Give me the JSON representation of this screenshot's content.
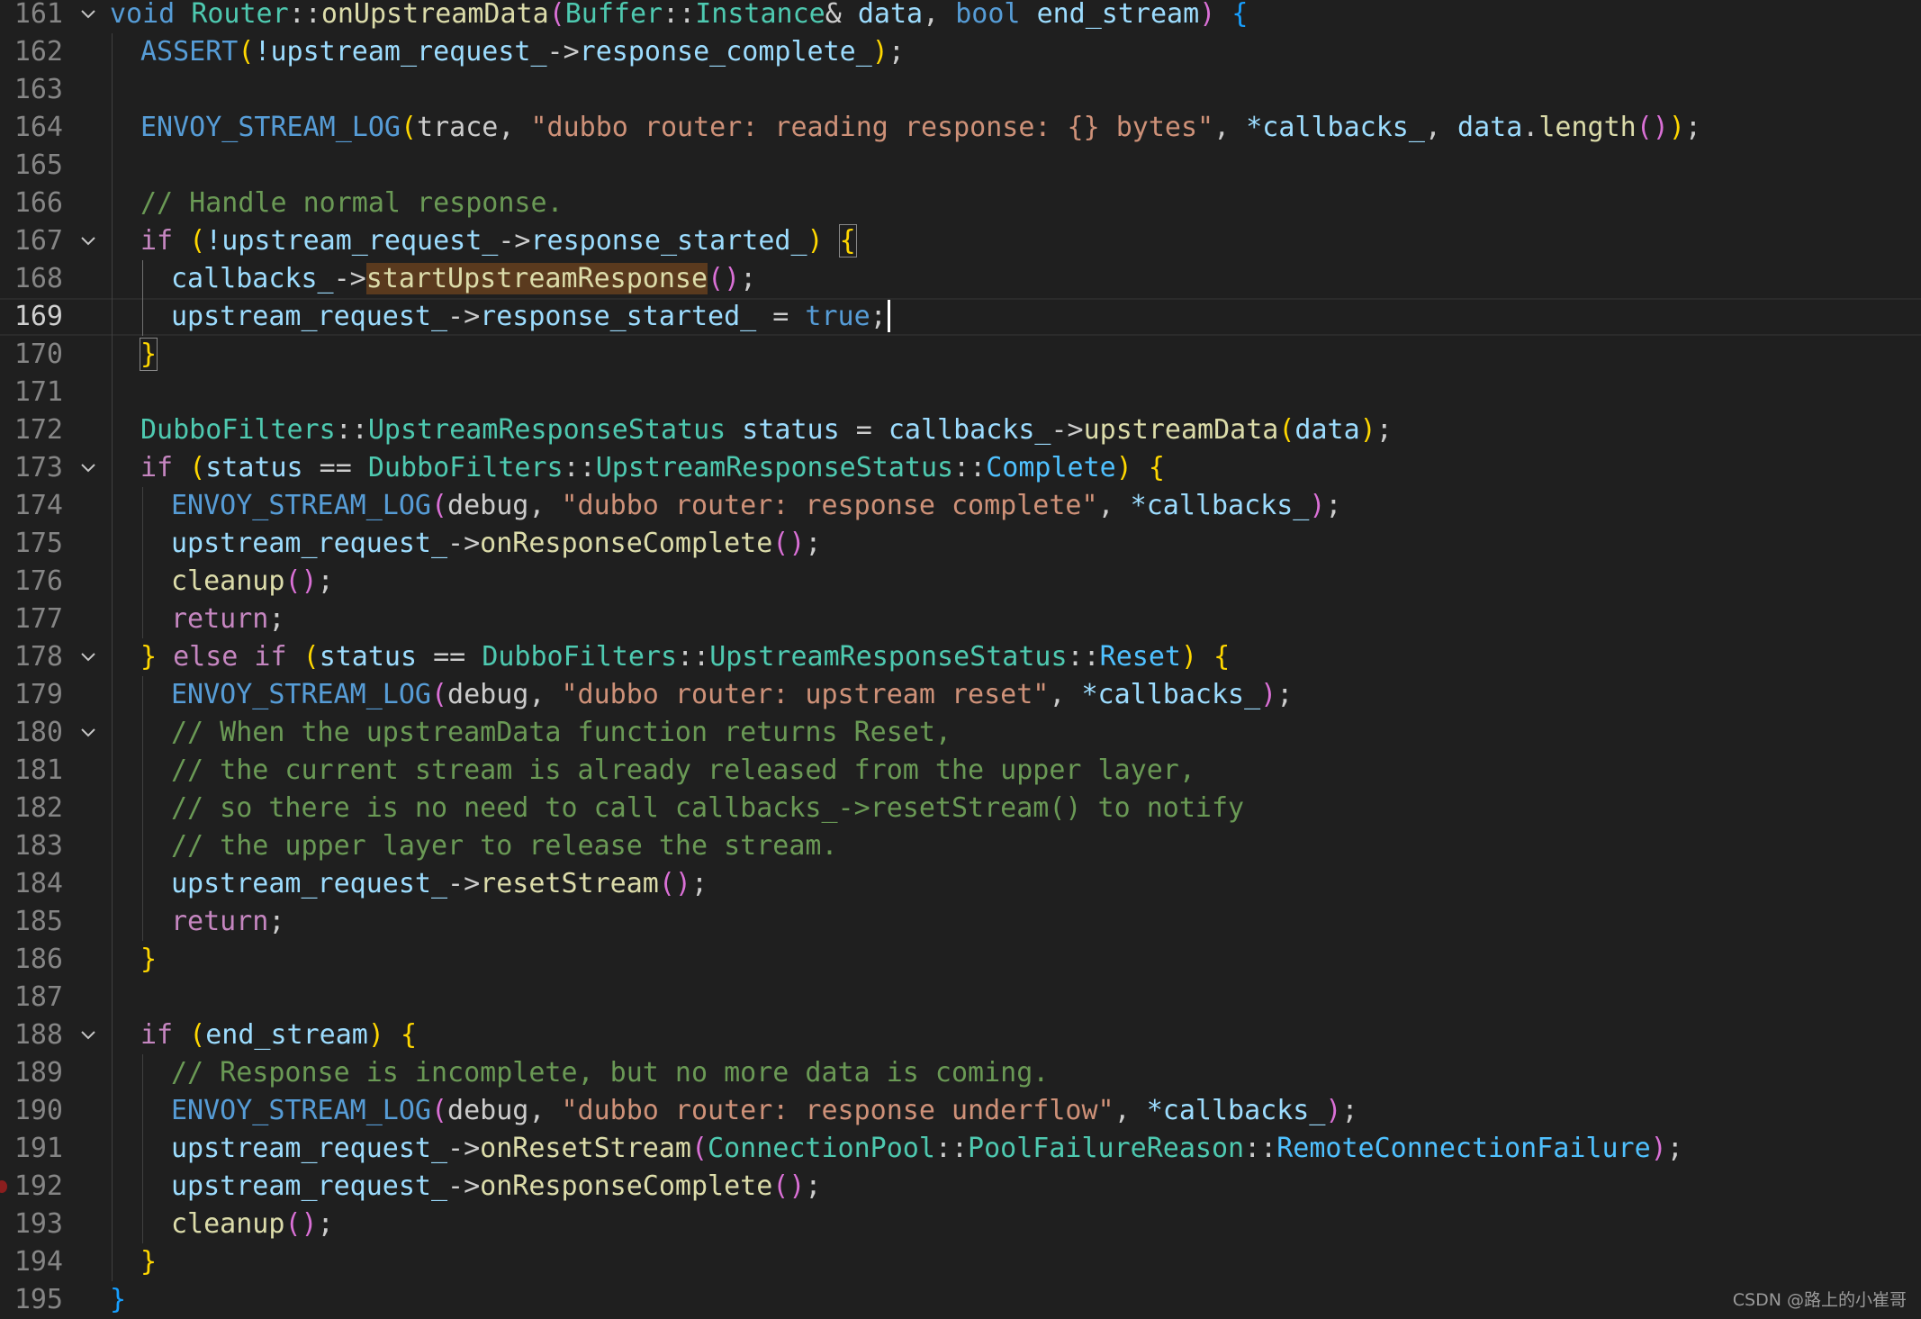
{
  "editor": {
    "active_line": 169,
    "breakpoint_line": 192,
    "lines": [
      {
        "n": "161",
        "fold": true,
        "indent": 0,
        "tokens": [
          [
            "void ",
            "#569cd6"
          ],
          [
            "Router",
            "#4ec9b0"
          ],
          [
            "::",
            "#cccccc"
          ],
          [
            "onUpstreamData",
            "#dcdcaa"
          ],
          [
            "(",
            "#da70d6"
          ],
          [
            "Buffer",
            "#4ec9b0"
          ],
          [
            "::",
            "#cccccc"
          ],
          [
            "Instance",
            "#4ec9b0"
          ],
          [
            "& ",
            "#cccccc"
          ],
          [
            "data",
            "#9cdcfe"
          ],
          [
            ", ",
            "#cccccc"
          ],
          [
            "bool ",
            "#569cd6"
          ],
          [
            "end_stream",
            "#9cdcfe"
          ],
          [
            ") ",
            "#da70d6"
          ],
          [
            "{",
            "#179fff"
          ]
        ]
      },
      {
        "n": "162",
        "fold": false,
        "indent": 1,
        "tokens": [
          [
            "ASSERT",
            "#569cd6"
          ],
          [
            "(",
            "#ffd700"
          ],
          [
            "!upstream_request_",
            "#9cdcfe"
          ],
          [
            "->",
            "#cccccc"
          ],
          [
            "response_complete_",
            "#9cdcfe"
          ],
          [
            ")",
            "#ffd700"
          ],
          [
            ";",
            "#cccccc"
          ]
        ]
      },
      {
        "n": "163",
        "fold": false,
        "indent": 1,
        "tokens": []
      },
      {
        "n": "164",
        "fold": false,
        "indent": 1,
        "tokens": [
          [
            "ENVOY_STREAM_LOG",
            "#569cd6"
          ],
          [
            "(",
            "#ffd700"
          ],
          [
            "trace",
            "#cccccc"
          ],
          [
            ", ",
            "#cccccc"
          ],
          [
            "\"dubbo router: reading response: {} bytes\"",
            "#ce9178"
          ],
          [
            ", ",
            "#cccccc"
          ],
          [
            "*callbacks_",
            "#9cdcfe"
          ],
          [
            ", ",
            "#cccccc"
          ],
          [
            "data",
            "#9cdcfe"
          ],
          [
            ".",
            "#cccccc"
          ],
          [
            "length",
            "#dcdcaa"
          ],
          [
            "()",
            "#da70d6"
          ],
          [
            ")",
            "#ffd700"
          ],
          [
            ";",
            "#cccccc"
          ]
        ]
      },
      {
        "n": "165",
        "fold": false,
        "indent": 1,
        "tokens": []
      },
      {
        "n": "166",
        "fold": false,
        "indent": 1,
        "tokens": [
          [
            "// Handle normal response.",
            "#6a9955"
          ]
        ]
      },
      {
        "n": "167",
        "fold": true,
        "indent": 1,
        "tokens": [
          [
            "if ",
            "#c586c0"
          ],
          [
            "(",
            "#ffd700"
          ],
          [
            "!upstream_request_",
            "#9cdcfe"
          ],
          [
            "->",
            "#cccccc"
          ],
          [
            "response_started_",
            "#9cdcfe"
          ],
          [
            ")",
            "#ffd700"
          ],
          [
            " ",
            "#cccccc"
          ],
          [
            "{",
            "#ffd700",
            "bm"
          ]
        ]
      },
      {
        "n": "168",
        "fold": false,
        "indent": 2,
        "tokens": [
          [
            "callbacks_",
            "#9cdcfe"
          ],
          [
            "->",
            "#cccccc"
          ],
          [
            "startUpstreamResponse",
            "#dcdcaa",
            "hl"
          ],
          [
            "()",
            "#da70d6"
          ],
          [
            ";",
            "#cccccc"
          ]
        ]
      },
      {
        "n": "169",
        "fold": false,
        "indent": 2,
        "cursor": true,
        "tokens": [
          [
            "upstream_request_",
            "#9cdcfe"
          ],
          [
            "->",
            "#cccccc"
          ],
          [
            "response_started_",
            "#9cdcfe"
          ],
          [
            " = ",
            "#cccccc"
          ],
          [
            "true",
            "#569cd6"
          ],
          [
            ";",
            "#cccccc"
          ]
        ]
      },
      {
        "n": "170",
        "fold": false,
        "indent": 1,
        "tokens": [
          [
            "}",
            "#ffd700",
            "bm"
          ]
        ]
      },
      {
        "n": "171",
        "fold": false,
        "indent": 1,
        "tokens": []
      },
      {
        "n": "172",
        "fold": false,
        "indent": 1,
        "tokens": [
          [
            "DubboFilters",
            "#4ec9b0"
          ],
          [
            "::",
            "#cccccc"
          ],
          [
            "UpstreamResponseStatus",
            "#4ec9b0"
          ],
          [
            " ",
            "#cccccc"
          ],
          [
            "status",
            "#9cdcfe"
          ],
          [
            " = ",
            "#cccccc"
          ],
          [
            "callbacks_",
            "#9cdcfe"
          ],
          [
            "->",
            "#cccccc"
          ],
          [
            "upstreamData",
            "#dcdcaa"
          ],
          [
            "(",
            "#ffd700"
          ],
          [
            "data",
            "#9cdcfe"
          ],
          [
            ")",
            "#ffd700"
          ],
          [
            ";",
            "#cccccc"
          ]
        ]
      },
      {
        "n": "173",
        "fold": true,
        "indent": 1,
        "tokens": [
          [
            "if ",
            "#c586c0"
          ],
          [
            "(",
            "#ffd700"
          ],
          [
            "status",
            "#9cdcfe"
          ],
          [
            " == ",
            "#cccccc"
          ],
          [
            "DubboFilters",
            "#4ec9b0"
          ],
          [
            "::",
            "#cccccc"
          ],
          [
            "UpstreamResponseStatus",
            "#4ec9b0"
          ],
          [
            "::",
            "#cccccc"
          ],
          [
            "Complete",
            "#4fc1ff"
          ],
          [
            ")",
            "#ffd700"
          ],
          [
            " ",
            "#cccccc"
          ],
          [
            "{",
            "#ffd700"
          ]
        ]
      },
      {
        "n": "174",
        "fold": false,
        "indent": 2,
        "tokens": [
          [
            "ENVOY_STREAM_LOG",
            "#569cd6"
          ],
          [
            "(",
            "#da70d6"
          ],
          [
            "debug",
            "#cccccc"
          ],
          [
            ", ",
            "#cccccc"
          ],
          [
            "\"dubbo router: response complete\"",
            "#ce9178"
          ],
          [
            ", ",
            "#cccccc"
          ],
          [
            "*callbacks_",
            "#9cdcfe"
          ],
          [
            ")",
            "#da70d6"
          ],
          [
            ";",
            "#cccccc"
          ]
        ]
      },
      {
        "n": "175",
        "fold": false,
        "indent": 2,
        "tokens": [
          [
            "upstream_request_",
            "#9cdcfe"
          ],
          [
            "->",
            "#cccccc"
          ],
          [
            "onResponseComplete",
            "#dcdcaa"
          ],
          [
            "()",
            "#da70d6"
          ],
          [
            ";",
            "#cccccc"
          ]
        ]
      },
      {
        "n": "176",
        "fold": false,
        "indent": 2,
        "tokens": [
          [
            "cleanup",
            "#dcdcaa"
          ],
          [
            "()",
            "#da70d6"
          ],
          [
            ";",
            "#cccccc"
          ]
        ]
      },
      {
        "n": "177",
        "fold": false,
        "indent": 2,
        "tokens": [
          [
            "return",
            "#c586c0"
          ],
          [
            ";",
            "#cccccc"
          ]
        ]
      },
      {
        "n": "178",
        "fold": true,
        "indent": 1,
        "tokens": [
          [
            "} ",
            "#ffd700"
          ],
          [
            "else if ",
            "#c586c0"
          ],
          [
            "(",
            "#ffd700"
          ],
          [
            "status",
            "#9cdcfe"
          ],
          [
            " == ",
            "#cccccc"
          ],
          [
            "DubboFilters",
            "#4ec9b0"
          ],
          [
            "::",
            "#cccccc"
          ],
          [
            "UpstreamResponseStatus",
            "#4ec9b0"
          ],
          [
            "::",
            "#cccccc"
          ],
          [
            "Reset",
            "#4fc1ff"
          ],
          [
            ")",
            "#ffd700"
          ],
          [
            " ",
            "#cccccc"
          ],
          [
            "{",
            "#ffd700"
          ]
        ]
      },
      {
        "n": "179",
        "fold": false,
        "indent": 2,
        "tokens": [
          [
            "ENVOY_STREAM_LOG",
            "#569cd6"
          ],
          [
            "(",
            "#da70d6"
          ],
          [
            "debug",
            "#cccccc"
          ],
          [
            ", ",
            "#cccccc"
          ],
          [
            "\"dubbo router: upstream reset\"",
            "#ce9178"
          ],
          [
            ", ",
            "#cccccc"
          ],
          [
            "*callbacks_",
            "#9cdcfe"
          ],
          [
            ")",
            "#da70d6"
          ],
          [
            ";",
            "#cccccc"
          ]
        ]
      },
      {
        "n": "180",
        "fold": true,
        "indent": 2,
        "tokens": [
          [
            "// When the upstreamData function returns Reset,",
            "#6a9955"
          ]
        ]
      },
      {
        "n": "181",
        "fold": false,
        "indent": 2,
        "tokens": [
          [
            "// the current stream is already released from the upper layer,",
            "#6a9955"
          ]
        ]
      },
      {
        "n": "182",
        "fold": false,
        "indent": 2,
        "tokens": [
          [
            "// so there is no need to call callbacks_->resetStream() to notify",
            "#6a9955"
          ]
        ]
      },
      {
        "n": "183",
        "fold": false,
        "indent": 2,
        "tokens": [
          [
            "// the upper layer to release the stream.",
            "#6a9955"
          ]
        ]
      },
      {
        "n": "184",
        "fold": false,
        "indent": 2,
        "tokens": [
          [
            "upstream_request_",
            "#9cdcfe"
          ],
          [
            "->",
            "#cccccc"
          ],
          [
            "resetStream",
            "#dcdcaa"
          ],
          [
            "()",
            "#da70d6"
          ],
          [
            ";",
            "#cccccc"
          ]
        ]
      },
      {
        "n": "185",
        "fold": false,
        "indent": 2,
        "tokens": [
          [
            "return",
            "#c586c0"
          ],
          [
            ";",
            "#cccccc"
          ]
        ]
      },
      {
        "n": "186",
        "fold": false,
        "indent": 1,
        "tokens": [
          [
            "}",
            "#ffd700"
          ]
        ]
      },
      {
        "n": "187",
        "fold": false,
        "indent": 1,
        "tokens": []
      },
      {
        "n": "188",
        "fold": true,
        "indent": 1,
        "tokens": [
          [
            "if ",
            "#c586c0"
          ],
          [
            "(",
            "#ffd700"
          ],
          [
            "end_stream",
            "#9cdcfe"
          ],
          [
            ")",
            "#ffd700"
          ],
          [
            " ",
            "#cccccc"
          ],
          [
            "{",
            "#ffd700"
          ]
        ]
      },
      {
        "n": "189",
        "fold": false,
        "indent": 2,
        "tokens": [
          [
            "// Response is incomplete, but no more data is coming.",
            "#6a9955"
          ]
        ]
      },
      {
        "n": "190",
        "fold": false,
        "indent": 2,
        "tokens": [
          [
            "ENVOY_STREAM_LOG",
            "#569cd6"
          ],
          [
            "(",
            "#da70d6"
          ],
          [
            "debug",
            "#cccccc"
          ],
          [
            ", ",
            "#cccccc"
          ],
          [
            "\"dubbo router: response underflow\"",
            "#ce9178"
          ],
          [
            ", ",
            "#cccccc"
          ],
          [
            "*callbacks_",
            "#9cdcfe"
          ],
          [
            ")",
            "#da70d6"
          ],
          [
            ";",
            "#cccccc"
          ]
        ]
      },
      {
        "n": "191",
        "fold": false,
        "indent": 2,
        "tokens": [
          [
            "upstream_request_",
            "#9cdcfe"
          ],
          [
            "->",
            "#cccccc"
          ],
          [
            "onResetStream",
            "#dcdcaa"
          ],
          [
            "(",
            "#da70d6"
          ],
          [
            "ConnectionPool",
            "#4ec9b0"
          ],
          [
            "::",
            "#cccccc"
          ],
          [
            "PoolFailureReason",
            "#4ec9b0"
          ],
          [
            "::",
            "#cccccc"
          ],
          [
            "RemoteConnectionFailure",
            "#4fc1ff"
          ],
          [
            ")",
            "#da70d6"
          ],
          [
            ";",
            "#cccccc"
          ]
        ]
      },
      {
        "n": "192",
        "fold": false,
        "indent": 2,
        "tokens": [
          [
            "upstream_request_",
            "#9cdcfe"
          ],
          [
            "->",
            "#cccccc"
          ],
          [
            "onResponseComplete",
            "#dcdcaa"
          ],
          [
            "()",
            "#da70d6"
          ],
          [
            ";",
            "#cccccc"
          ]
        ]
      },
      {
        "n": "193",
        "fold": false,
        "indent": 2,
        "tokens": [
          [
            "cleanup",
            "#dcdcaa"
          ],
          [
            "()",
            "#da70d6"
          ],
          [
            ";",
            "#cccccc"
          ]
        ]
      },
      {
        "n": "194",
        "fold": false,
        "indent": 1,
        "tokens": [
          [
            "}",
            "#ffd700"
          ]
        ]
      },
      {
        "n": "195",
        "fold": false,
        "indent": 0,
        "tokens": [
          [
            "}",
            "#179fff"
          ]
        ]
      }
    ]
  },
  "watermark": "CSDN @路上的小崔哥"
}
